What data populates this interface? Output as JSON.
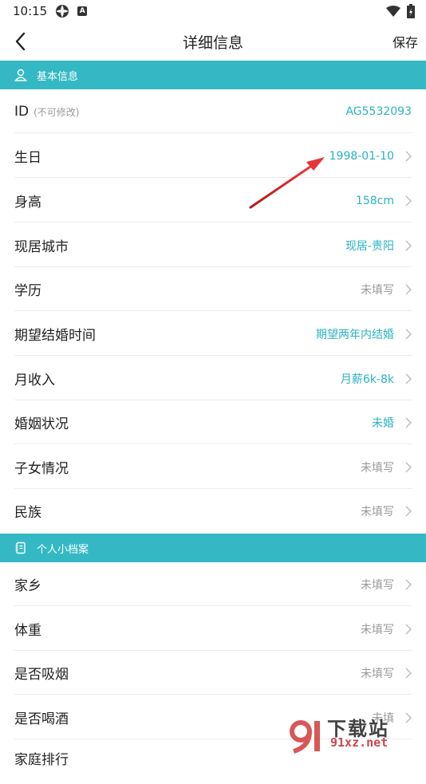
{
  "status_bar": {
    "time": "10:15"
  },
  "header": {
    "title": "详细信息",
    "save_label": "保存"
  },
  "sections": {
    "basic": {
      "title": "基本信息"
    },
    "profile": {
      "title": "个人小档案"
    }
  },
  "rows": {
    "id": {
      "label": "ID",
      "sub": "(不可修改)",
      "value": "AG5532093"
    },
    "birthday": {
      "label": "生日",
      "value": "1998-01-10"
    },
    "height": {
      "label": "身高",
      "value": "158cm"
    },
    "city": {
      "label": "现居城市",
      "value": "现居-贵阳"
    },
    "education": {
      "label": "学历",
      "value": "未填写"
    },
    "marriage_time": {
      "label": "期望结婚时间",
      "value": "期望两年内结婚"
    },
    "income": {
      "label": "月收入",
      "value": "月薪6k-8k"
    },
    "marital_status": {
      "label": "婚姻状况",
      "value": "未婚"
    },
    "children": {
      "label": "子女情况",
      "value": "未填写"
    },
    "ethnicity": {
      "label": "民族",
      "value": "未填写"
    },
    "hometown": {
      "label": "家乡",
      "value": "未填写"
    },
    "weight": {
      "label": "体重",
      "value": "未填写"
    },
    "smoking": {
      "label": "是否吸烟",
      "value": "未填写"
    },
    "drinking": {
      "label": "是否喝酒",
      "value": "未填"
    },
    "family_rank": {
      "label": "家庭排行"
    }
  },
  "watermark": {
    "text_cn": "下载站",
    "text_url": "91xz.net"
  },
  "colors": {
    "accent": "#34b9c4",
    "value_filled": "#2ab3c0",
    "value_empty": "#999999",
    "annotation_arrow": "#d42a2a"
  }
}
